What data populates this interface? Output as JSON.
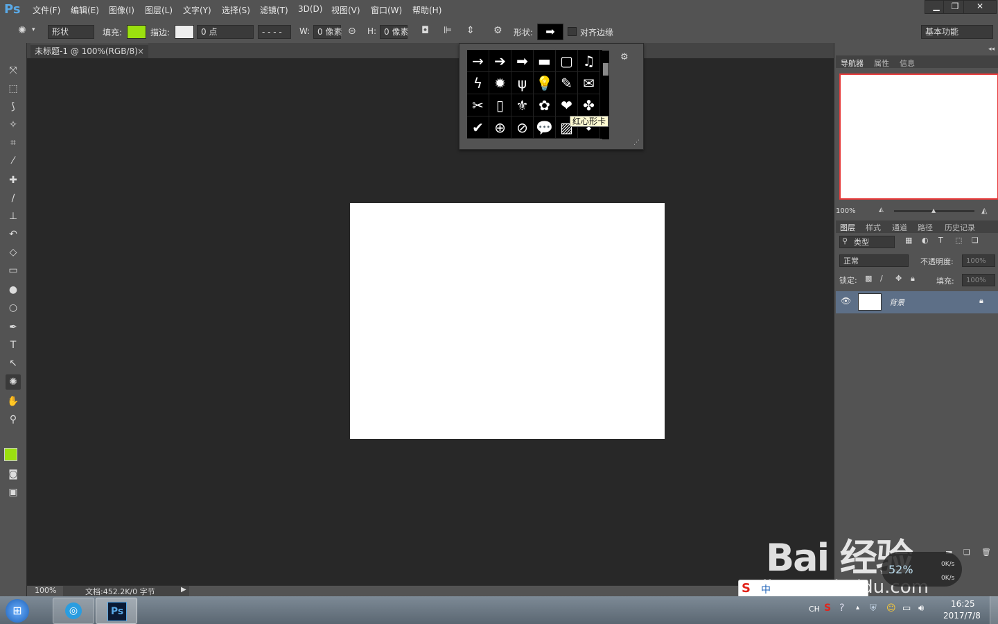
{
  "app": {
    "logo": "Ps"
  },
  "menu": [
    "文件(F)",
    "编辑(E)",
    "图像(I)",
    "图层(L)",
    "文字(Y)",
    "选择(S)",
    "滤镜(T)",
    "3D(D)",
    "视图(V)",
    "窗口(W)",
    "帮助(H)"
  ],
  "window_controls": {
    "minimize": "▁",
    "restore": "❐",
    "close": "✕"
  },
  "options": {
    "mode_value": "形状",
    "fill_label": "填充:",
    "fill_color": "#9be00f",
    "stroke_label": "描边:",
    "stroke_width": "0 点",
    "w_label": "W:",
    "w_value": "0 像素",
    "h_label": "H:",
    "h_value": "0 像素",
    "shape_label": "形状:",
    "align_edges_label": "对齐边缘",
    "workspace": "基本功能"
  },
  "document": {
    "tab_title": "未标题-1 @ 100%(RGB/8)",
    "zoom": "100%",
    "doc_info": "文档:452.2K/0 字节"
  },
  "shape_picker": {
    "shapes": [
      "→",
      "➔",
      "➡",
      "▬",
      "▢",
      "♫",
      "ϟ",
      "✹",
      "ψ",
      "💡",
      "✎",
      "✉",
      "✂",
      "▯",
      "⚜",
      "✿",
      "❤",
      "✤",
      "✔",
      "⊕",
      "⊘",
      "💬",
      "▨",
      "⬩"
    ],
    "tooltip": "红心形卡"
  },
  "navigator": {
    "tabs": [
      "导航器",
      "属性",
      "信息"
    ],
    "zoom": "100%"
  },
  "layers": {
    "tabs": [
      "图层",
      "样式",
      "通道",
      "路径",
      "历史记录"
    ],
    "filter_kind": "类型",
    "blend_mode": "正常",
    "opacity_label": "不透明度:",
    "opacity_value": "100%",
    "lock_label": "锁定:",
    "fill_label": "填充:",
    "fill_value": "100%",
    "items": [
      {
        "name": "背景"
      }
    ]
  },
  "taskbar": {
    "lang": "CH",
    "time": "16:25",
    "date": "2017/7/8",
    "ime": "中",
    "net_percent": "52%",
    "net_up": "0K/s",
    "net_down": "0K/s"
  },
  "watermark": {
    "text": "Bai 经验",
    "sub": "jingyan.baidu.com"
  },
  "colors": {
    "foreground": "#9be00f",
    "background": "#000000",
    "accent": "#5aa9e6"
  }
}
